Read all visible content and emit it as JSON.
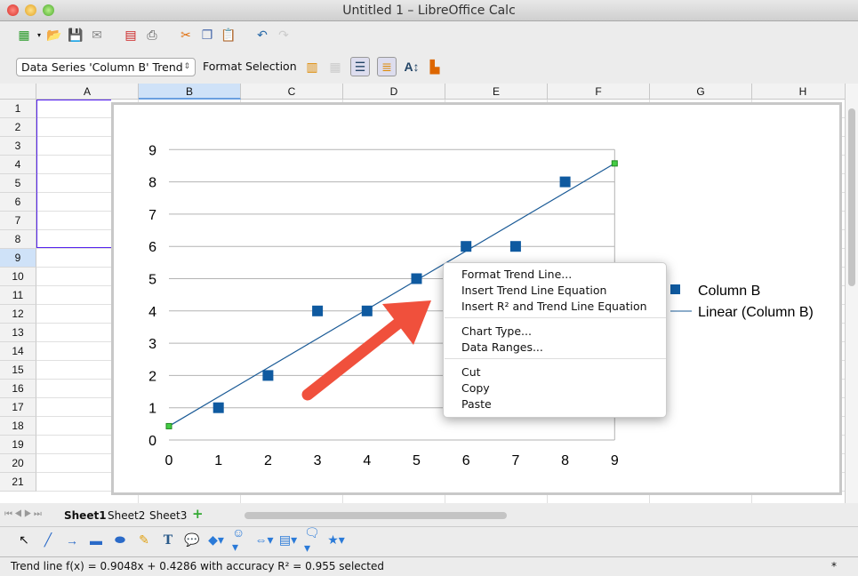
{
  "window": {
    "title": "Untitled 1 – LibreOffice Calc"
  },
  "toolbar": {
    "icons": [
      "new-spreadsheet-icon",
      "open-folder-icon",
      "save-icon",
      "email-icon",
      "export-pdf-icon",
      "print-icon",
      "cut-icon",
      "copy-icon",
      "paste-icon",
      "undo-icon",
      "redo-icon"
    ]
  },
  "format_toolbar": {
    "selected_element": "Data Series 'Column B' Trend",
    "format_selection_label": "Format Selection"
  },
  "columns": [
    "A",
    "B",
    "C",
    "D",
    "E",
    "F",
    "G",
    "H"
  ],
  "rows": [
    "1",
    "2",
    "3",
    "4",
    "5",
    "6",
    "7",
    "8",
    "9",
    "10",
    "11",
    "12",
    "13",
    "14",
    "15",
    "16",
    "17",
    "18",
    "19",
    "20",
    "21"
  ],
  "selected_column": "B",
  "selected_row": "9",
  "chart_data": {
    "type": "scatter",
    "series": [
      {
        "name": "Column B",
        "x": [
          1,
          2,
          3,
          4,
          5,
          6,
          7,
          8
        ],
        "y": [
          1,
          2,
          4,
          4,
          5,
          6,
          6,
          8
        ],
        "color": "#0f5aa0"
      }
    ],
    "trendline": {
      "name": "Linear (Column B)",
      "type": "linear",
      "slope": 0.9048,
      "intercept": 0.4286,
      "r2": 0.955,
      "color": "#1a5a96"
    },
    "xlim": [
      0,
      9
    ],
    "ylim": [
      0,
      9
    ],
    "xticks": [
      "0",
      "1",
      "2",
      "3",
      "4",
      "5",
      "6",
      "7",
      "8",
      "9"
    ],
    "yticks": [
      "0",
      "1",
      "2",
      "3",
      "4",
      "5",
      "6",
      "7",
      "8",
      "9"
    ],
    "grid": true,
    "legend": "right"
  },
  "context_menu": {
    "groups": [
      [
        "Format Trend Line...",
        "Insert Trend Line Equation",
        "Insert R² and Trend Line Equation"
      ],
      [
        "Chart Type...",
        "Data Ranges..."
      ],
      [
        "Cut",
        "Copy",
        "Paste"
      ]
    ]
  },
  "sheet_tabs": [
    "Sheet1",
    "Sheet2",
    "Sheet3"
  ],
  "active_sheet": "Sheet1",
  "status": {
    "text": "Trend line f(x) = 0.9048x + 0.4286 with accuracy R² = 0.955 selected",
    "mode": "*"
  },
  "annotation_arrow_color": "#f0503c"
}
